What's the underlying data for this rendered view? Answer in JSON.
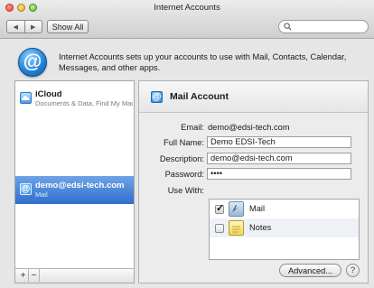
{
  "window": {
    "title": "Internet Accounts"
  },
  "toolbar": {
    "back_glyph": "◀",
    "forward_glyph": "▶",
    "show_all_label": "Show All",
    "search_placeholder": ""
  },
  "intro": {
    "icon_glyph": "@",
    "text": "Internet Accounts sets up your accounts to use with Mail, Contacts, Calendar, Messages, and other apps."
  },
  "sidebar": {
    "accounts": [
      {
        "name": "iCloud",
        "subtitle": "Documents & Data, Find My Mac",
        "selected": false,
        "icon": "icloud-icon"
      },
      {
        "name": "demo@edsi-tech.com",
        "subtitle": "Mail",
        "selected": true,
        "icon": "at-sign-icon"
      }
    ],
    "add_label": "+",
    "remove_label": "−"
  },
  "detail": {
    "icon_glyph": "@",
    "title": "Mail Account",
    "email_label": "Email:",
    "email_value": "demo@edsi-tech.com",
    "fullname_label": "Full Name:",
    "fullname_value": "Demo EDSI-Tech",
    "description_label": "Description:",
    "description_value": "demo@edsi-tech.com",
    "password_label": "Password:",
    "password_value": "••••",
    "use_with_label": "Use With:",
    "use_with": [
      {
        "name": "Mail",
        "checked": true,
        "icon": "mail-app-icon"
      },
      {
        "name": "Notes",
        "checked": false,
        "icon": "notes-app-icon"
      }
    ],
    "advanced_label": "Advanced...",
    "help_label": "?"
  },
  "colors": {
    "selection": "#2f6fcb",
    "accent": "#1f7fd6"
  }
}
